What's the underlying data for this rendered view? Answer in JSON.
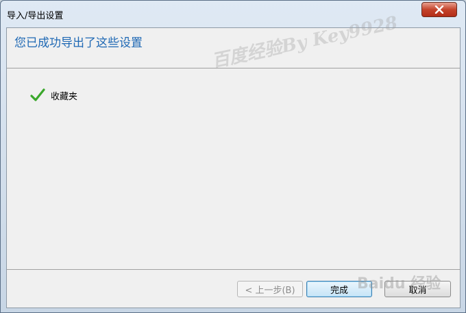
{
  "window": {
    "title": "导入/导出设置",
    "colors": {
      "heading": "#1e68b4",
      "close": "#c4432b",
      "check": "#3aa72b"
    }
  },
  "main": {
    "heading": "您已成功导出了这些设置",
    "items": [
      {
        "label": "收藏夹",
        "icon": "checkmark-icon"
      }
    ]
  },
  "buttons": {
    "back": "< 上一步(B)",
    "finish": "完成",
    "cancel": "取消"
  },
  "watermark": {
    "text": "百度经验By Key9928",
    "logo": "Baidu 经验"
  }
}
